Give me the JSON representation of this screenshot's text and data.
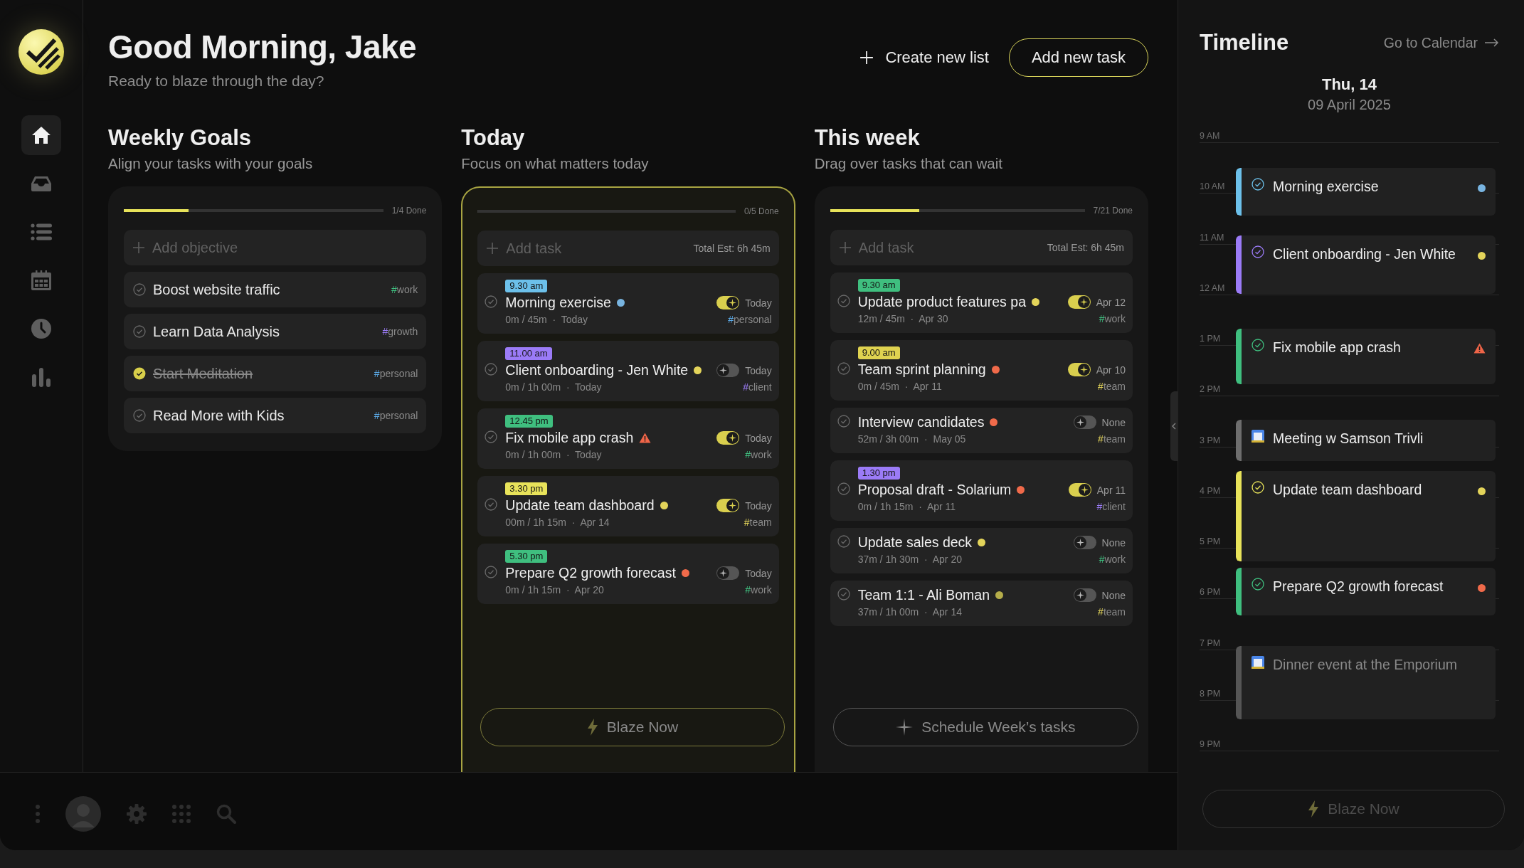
{
  "sidebar": {
    "items": [
      {
        "kind": "home",
        "selected": true
      },
      {
        "kind": "inbox",
        "selected": false
      },
      {
        "kind": "list",
        "selected": false
      },
      {
        "kind": "calendar",
        "selected": false
      },
      {
        "kind": "clock",
        "selected": false
      },
      {
        "kind": "chart",
        "selected": false
      }
    ]
  },
  "header": {
    "greeting": "Good Morning, Jake",
    "subtitle": "Ready to blaze through the day?",
    "create_list": "Create new list",
    "add_task": "Add new task"
  },
  "columns": [
    {
      "kind": "goals",
      "title": "Weekly Goals",
      "subtitle": "Align your tasks with your goals",
      "highlighted": false,
      "progress": {
        "level": 0.25,
        "label": "1/4 Done"
      },
      "add_placeholder": "Add objective",
      "goals": [
        {
          "text": "Boost website traffic",
          "checked": false,
          "tag": {
            "text": "#work",
            "color": "#3fbf7f"
          }
        },
        {
          "text": "Learn Data Analysis",
          "checked": false,
          "tag": {
            "text": "#growth",
            "color": "#9b7bf7"
          }
        },
        {
          "text": "Start Meditation",
          "checked": true,
          "tag": {
            "text": "#personal",
            "color": "#5aa9e6"
          }
        },
        {
          "text": "Read More with Kids",
          "checked": false,
          "tag": {
            "text": "#personal",
            "color": "#5aa9e6"
          }
        }
      ]
    },
    {
      "kind": "tasks",
      "title": "Today",
      "subtitle": "Focus on what matters today",
      "highlighted": true,
      "progress": {
        "level": 0,
        "label": "0/5 Done"
      },
      "add_placeholder": "Add task",
      "estimate": "Total Est: 6h 45m",
      "tasks": [
        {
          "time": {
            "label": "9.30 am",
            "color": "#6cc0ea"
          },
          "title": "Morning exercise",
          "marker": {
            "kind": "dot",
            "color": "#78b4e0"
          },
          "auto": true,
          "when": "Today",
          "meta": "0m / 45m  ·  Today",
          "tag": {
            "text": "#personal",
            "color": "#5aa9e6"
          }
        },
        {
          "time": {
            "label": "11.00 am",
            "color": "#9b7bf7"
          },
          "title": "Client onboarding - Jen White",
          "marker": {
            "kind": "dot",
            "color": "#e3d45a"
          },
          "auto": false,
          "when": "Today",
          "meta": "0m / 1h 00m  ·  Today",
          "tag": {
            "text": "#client",
            "color": "#9b7bf7"
          }
        },
        {
          "time": {
            "label": "12.45 pm",
            "color": "#3fbf7f"
          },
          "title": "Fix mobile app crash",
          "marker": {
            "kind": "warning"
          },
          "auto": true,
          "when": "Today",
          "meta": "0m / 1h 00m  ·  Today",
          "tag": {
            "text": "#work",
            "color": "#3fbf7f"
          }
        },
        {
          "time": {
            "label": "3.30 pm",
            "color": "#e8e35a"
          },
          "title": "Update team dashboard",
          "marker": {
            "kind": "dot",
            "color": "#e3d45a"
          },
          "auto": true,
          "when": "Today",
          "meta": "00m / 1h 15m  ·  Apr 14",
          "tag": {
            "text": "#team",
            "color": "#e3d45a"
          }
        },
        {
          "time": {
            "label": "5.30 pm",
            "color": "#3fbf7f"
          },
          "title": "Prepare Q2 growth forecast",
          "marker": {
            "kind": "dot",
            "color": "#f06a4a"
          },
          "auto": false,
          "when": "Today",
          "meta": "0m / 1h 15m  ·  Apr 20",
          "tag": {
            "text": "#work",
            "color": "#3fbf7f"
          }
        }
      ],
      "action": {
        "kind": "bolt",
        "label": "Blaze Now",
        "disabled": false
      }
    },
    {
      "kind": "tasks",
      "title": "This week",
      "subtitle": "Drag over tasks that can wait",
      "highlighted": false,
      "progress": {
        "level": 0.35,
        "label": "7/21 Done"
      },
      "add_placeholder": "Add task",
      "estimate": "Total Est: 6h 45m",
      "tasks": [
        {
          "time": {
            "label": "9.30 am",
            "color": "#3fbf7f"
          },
          "title": "Update product features pa",
          "marker": {
            "kind": "dot",
            "color": "#e3d45a"
          },
          "auto": true,
          "when": "Apr 12",
          "meta": "12m / 45m  ·  Apr 30",
          "tag": {
            "text": "#work",
            "color": "#3fbf7f"
          }
        },
        {
          "time": {
            "label": "9.00 am",
            "color": "#e0d350"
          },
          "title": "Team sprint planning",
          "marker": {
            "kind": "dot",
            "color": "#f06a4a"
          },
          "auto": true,
          "when": "Apr 10",
          "meta": "0m / 45m  ·  Apr 11",
          "tag": {
            "text": "#team",
            "color": "#e3d45a"
          }
        },
        {
          "title": "Interview candidates",
          "marker": {
            "kind": "dot",
            "color": "#f06a4a"
          },
          "auto": false,
          "when": "None",
          "meta": "52m / 3h 00m  ·  May 05",
          "tag": {
            "text": "#team",
            "color": "#e3d45a"
          }
        },
        {
          "time": {
            "label": "1.30 pm",
            "color": "#9b7bf7"
          },
          "title": "Proposal draft - Solarium",
          "marker": {
            "kind": "dot",
            "color": "#f06a4a"
          },
          "auto": true,
          "when": "Apr 11",
          "meta": "0m / 1h 15m  ·  Apr 11",
          "tag": {
            "text": "#client",
            "color": "#9b7bf7"
          }
        },
        {
          "title": "Update sales deck",
          "marker": {
            "kind": "dot",
            "color": "#e3d45a"
          },
          "auto": false,
          "when": "None",
          "meta": "37m / 1h 30m  ·  Apr 20",
          "tag": {
            "text": "#work",
            "color": "#3fbf7f"
          }
        },
        {
          "title": "Team 1:1 - Ali Boman",
          "marker": {
            "kind": "dot",
            "color": "#b5ad4a"
          },
          "auto": false,
          "when": "None",
          "meta": "37m / 1h 00m  ·  Apr 14",
          "tag": {
            "text": "#team",
            "color": "#e3d45a"
          }
        }
      ],
      "action": {
        "kind": "sparkle",
        "label": "Schedule Week’s tasks",
        "disabled": false
      }
    }
  ],
  "timeline": {
    "title": "Timeline",
    "link": "Go to Calendar",
    "day": "Thu, 14",
    "date": "09 April 2025",
    "hours": [
      "9 AM",
      "10 AM",
      "11 AM",
      "12 AM",
      "1 PM",
      "2 PM",
      "3 PM",
      "4 PM",
      "5 PM",
      "6 PM",
      "7 PM",
      "8 PM",
      "9 PM"
    ],
    "events": [
      {
        "kind": "task",
        "title": "Morning exercise",
        "color": "#6cc0ea",
        "marker": {
          "kind": "dot",
          "color": "#78b4e0"
        },
        "dimmed": false
      },
      {
        "kind": "task",
        "title": "Client onboarding - Jen White",
        "color": "#9b7bf7",
        "marker": {
          "kind": "dot",
          "color": "#e3d45a"
        },
        "dimmed": false
      },
      {
        "kind": "task",
        "title": "Fix mobile app crash",
        "color": "#3fbf7f",
        "marker": {
          "kind": "warning"
        },
        "dimmed": false
      },
      {
        "kind": "calendar",
        "title": "Meeting w Samson Trivli",
        "color": "#6e6e6e",
        "dimmed": false
      },
      {
        "kind": "task",
        "title": "Update team dashboard",
        "color": "#e8e35a",
        "marker": {
          "kind": "dot",
          "color": "#e3d45a"
        },
        "dimmed": false
      },
      {
        "kind": "task",
        "title": "Prepare Q2 growth forecast",
        "color": "#3fbf7f",
        "marker": {
          "kind": "dot",
          "color": "#f06a4a"
        },
        "dimmed": false
      },
      {
        "kind": "calendar",
        "title": "Dinner event at the Emporium",
        "color": "#555555",
        "dimmed": true
      }
    ],
    "action": {
      "kind": "bolt",
      "label": "Blaze Now",
      "disabled": true
    }
  }
}
